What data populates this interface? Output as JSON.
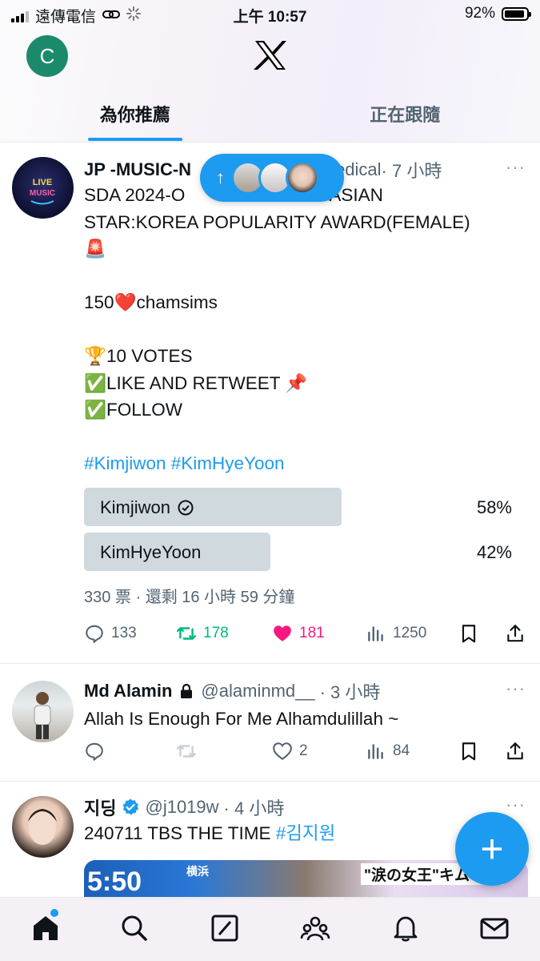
{
  "status_bar": {
    "carrier": "遠傳電信",
    "time": "上午 10:57",
    "battery": "92%"
  },
  "header": {
    "avatar_letter": "C",
    "tabs": [
      "為你推薦",
      "正在跟隨"
    ]
  },
  "pill": {
    "arrow": "↑"
  },
  "posts": [
    {
      "name": "JP -MUSIC-N",
      "handle_tail": "edical",
      "time": "· 7 小時",
      "more": "···",
      "lines": [
        "SDA 2024-O",
        "ASIAN",
        "STAR:KOREA POPULARITY AWARD(FEMALE)",
        "🚨",
        "150❤️chamsims",
        "🏆10 VOTES",
        "✅LIKE AND RETWEET 📌",
        "✅FOLLOW"
      ],
      "hashtags": "#Kimjiwon #KimHyeYoon",
      "poll": [
        {
          "label": "Kimjiwon",
          "pct": "58%",
          "value": 58
        },
        {
          "label": "KimHyeYoon",
          "pct": "42%",
          "value": 42
        }
      ],
      "poll_meta": "330 票 · 還剩 16 小時 59 分鐘",
      "actions": {
        "replies": "133",
        "reposts": "178",
        "likes": "181",
        "views": "1250"
      }
    },
    {
      "name": "Md Alamin",
      "handle": "@alaminmd__",
      "time": "· 3 小時",
      "more": "···",
      "text": "Allah Is Enough For Me Alhamdulillah ~",
      "actions": {
        "likes": "2",
        "views": "84"
      }
    },
    {
      "name": "지딩",
      "handle": "@j1019w",
      "time": "· 4 小時",
      "more": "···",
      "text": "240711 TBS THE TIME ",
      "hashtag": "#김지원",
      "media_text": {
        "clock": "5:50",
        "place": "横浜",
        "headline": "\"涙の女王\"キム・ジ"
      }
    }
  ],
  "fab": {
    "label": "+"
  },
  "colors": {
    "accent": "#1d9bf0",
    "repost": "#00ba7c",
    "like": "#f91880",
    "text": "#0f1419",
    "muted": "#536471"
  }
}
